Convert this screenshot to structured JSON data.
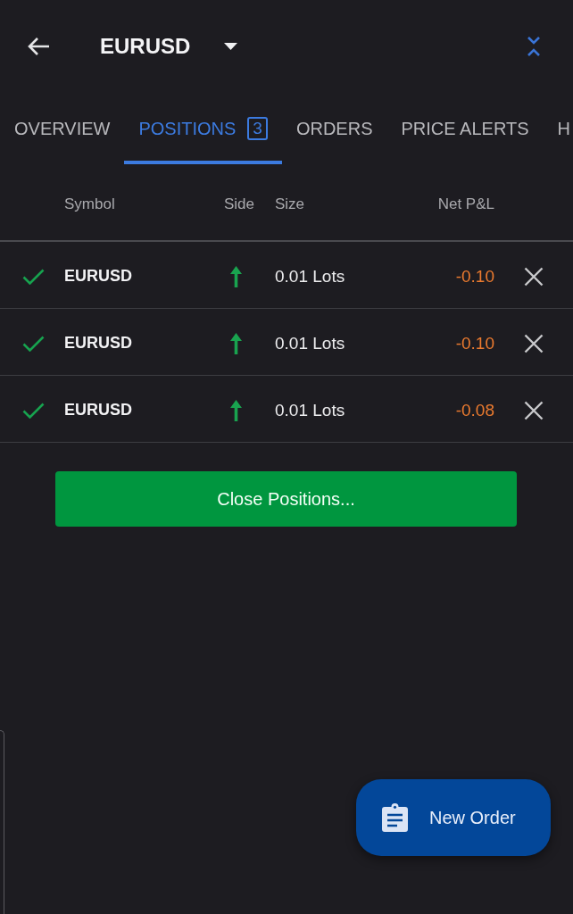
{
  "header": {
    "title": "EURUSD"
  },
  "tabs": [
    {
      "label": "OVERVIEW",
      "selected": false
    },
    {
      "label": "POSITIONS",
      "selected": true,
      "badge": "3"
    },
    {
      "label": "ORDERS",
      "selected": false
    },
    {
      "label": "PRICE ALERTS",
      "selected": false
    },
    {
      "label": "H",
      "selected": false
    }
  ],
  "table": {
    "columns": [
      "Symbol",
      "Side",
      "Size",
      "Net P&L"
    ],
    "rows": [
      {
        "symbol": "EURUSD",
        "buy": true,
        "size": "0.01 Lots",
        "net_pnl": "-0.10"
      },
      {
        "symbol": "EURUSD",
        "buy": true,
        "size": "0.01 Lots",
        "net_pnl": "-0.10"
      },
      {
        "symbol": "EURUSD",
        "buy": true,
        "size": "0.01 Lots",
        "net_pnl": "-0.08"
      }
    ]
  },
  "close_button": "Close Positions...",
  "fab": {
    "label": "New Order"
  }
}
